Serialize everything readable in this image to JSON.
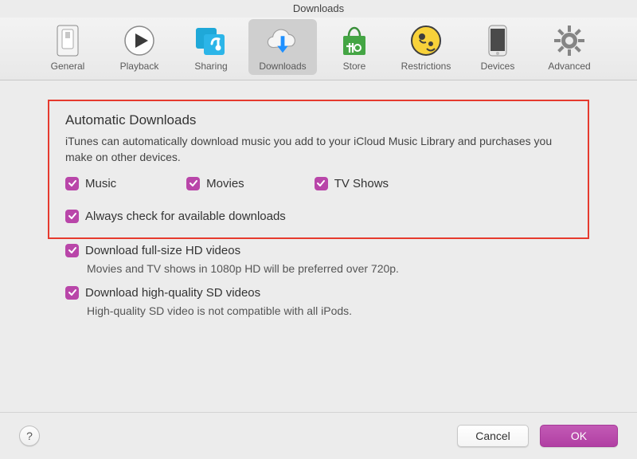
{
  "window": {
    "title": "Downloads"
  },
  "toolbar": [
    {
      "id": "general",
      "label": "General",
      "selected": false
    },
    {
      "id": "playback",
      "label": "Playback",
      "selected": false
    },
    {
      "id": "sharing",
      "label": "Sharing",
      "selected": false
    },
    {
      "id": "downloads",
      "label": "Downloads",
      "selected": true
    },
    {
      "id": "store",
      "label": "Store",
      "selected": false
    },
    {
      "id": "restrictions",
      "label": "Restrictions",
      "selected": false
    },
    {
      "id": "devices",
      "label": "Devices",
      "selected": false
    },
    {
      "id": "advanced",
      "label": "Advanced",
      "selected": false
    }
  ],
  "section": {
    "title": "Automatic Downloads",
    "desc": "iTunes can automatically download music you add to your iCloud Music Library and purchases you make on other devices.",
    "items": {
      "music": {
        "label": "Music",
        "checked": true
      },
      "movies": {
        "label": "Movies",
        "checked": true
      },
      "tvshows": {
        "label": "TV Shows",
        "checked": true
      }
    },
    "always": {
      "label": "Always check for available downloads",
      "checked": true
    }
  },
  "extras": {
    "hd": {
      "label": "Download full-size HD videos",
      "checked": true,
      "desc": "Movies and TV shows in 1080p HD will be preferred over 720p."
    },
    "sd": {
      "label": "Download high-quality SD videos",
      "checked": true,
      "desc": "High-quality SD video is not compatible with all iPods."
    }
  },
  "buttons": {
    "cancel": "Cancel",
    "ok": "OK",
    "help": "?"
  },
  "accent": "#b946a9"
}
